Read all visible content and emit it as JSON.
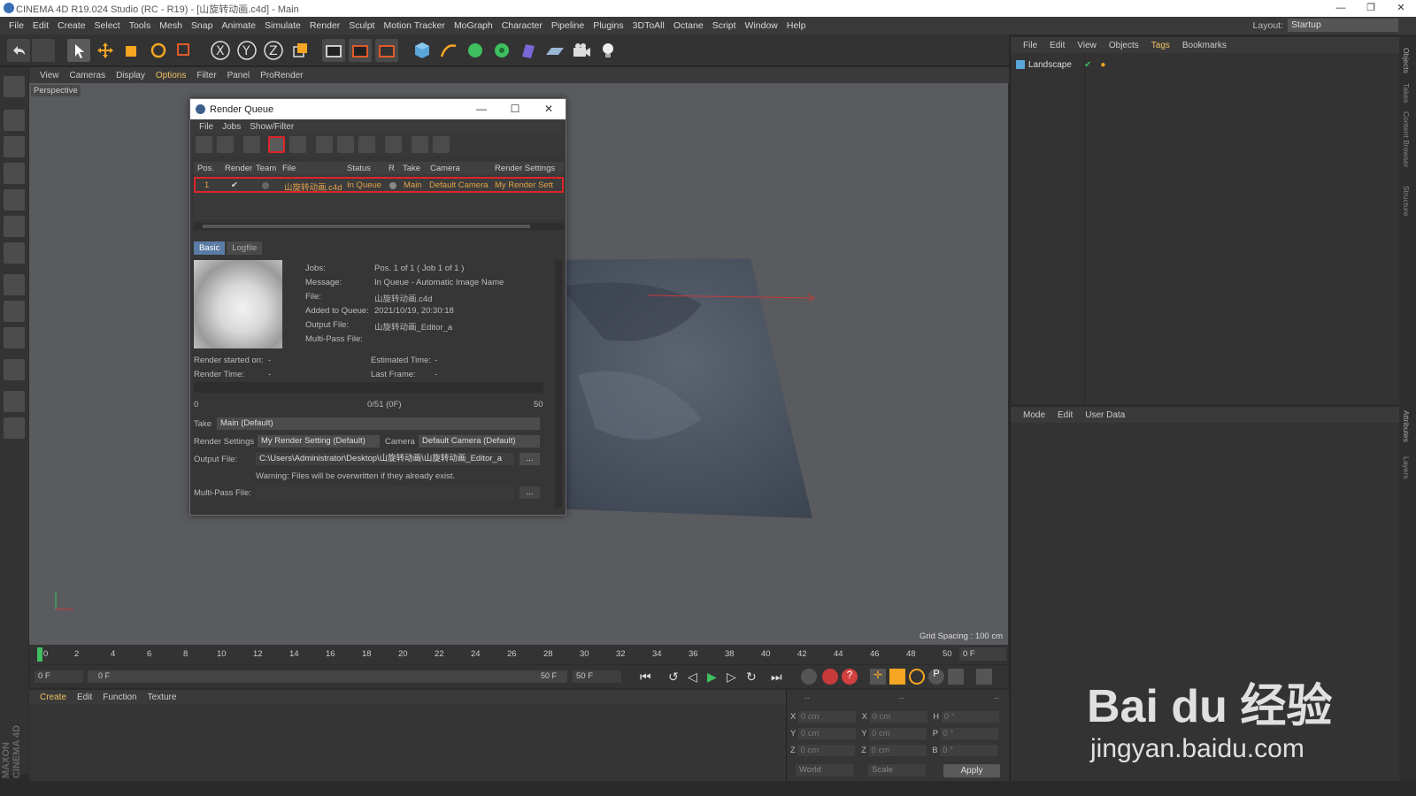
{
  "app": {
    "title": "CINEMA 4D R19.024 Studio (RC - R19) - [山旋转动画.c4d] - Main",
    "window_controls": [
      "—",
      "❐",
      "✕"
    ]
  },
  "menubar": {
    "items": [
      "File",
      "Edit",
      "Create",
      "Select",
      "Tools",
      "Mesh",
      "Snap",
      "Animate",
      "Simulate",
      "Render",
      "Sculpt",
      "Motion Tracker",
      "MoGraph",
      "Character",
      "Pipeline",
      "Plugins",
      "3DToAll",
      "Octane",
      "Script",
      "Window",
      "Help"
    ],
    "layout_label": "Layout:",
    "layout_value": "Startup"
  },
  "viewport_menu": {
    "items": [
      "View",
      "Cameras",
      "Display",
      "Options",
      "Filter",
      "Panel",
      "ProRender"
    ]
  },
  "viewport": {
    "label": "Perspective",
    "grid_spacing": "Grid Spacing : 100 cm"
  },
  "timeline": {
    "ticks": [
      "0",
      "2",
      "4",
      "6",
      "8",
      "10",
      "12",
      "14",
      "16",
      "18",
      "20",
      "22",
      "24",
      "26",
      "28",
      "30",
      "32",
      "34",
      "36",
      "38",
      "40",
      "42",
      "44",
      "46",
      "48",
      "50"
    ],
    "current_frame_field": "0 F",
    "start_field": "0 F",
    "range_start": "0 F",
    "range_end": "50 F",
    "end_field": "50 F"
  },
  "material_panel": {
    "menu": [
      "Create",
      "Edit",
      "Function",
      "Texture"
    ]
  },
  "coord_panel": {
    "header": [
      "--",
      "--",
      "--"
    ],
    "rows": [
      {
        "a": "X",
        "av": "0 cm",
        "b": "X",
        "bv": "0 cm",
        "c": "H",
        "cv": "0 °"
      },
      {
        "a": "Y",
        "av": "0 cm",
        "b": "Y",
        "bv": "0 cm",
        "c": "P",
        "cv": "0 °"
      },
      {
        "a": "Z",
        "av": "0 cm",
        "b": "Z",
        "bv": "0 cm",
        "c": "B",
        "cv": "0 °"
      }
    ],
    "world": "World",
    "scale": "Scale",
    "apply": "Apply"
  },
  "objects_panel": {
    "menu": [
      "File",
      "Edit",
      "View",
      "Objects",
      "Tags",
      "Bookmarks"
    ],
    "object_name": "Landscape"
  },
  "attributes_panel": {
    "menu": [
      "Mode",
      "Edit",
      "User Data"
    ]
  },
  "side_tabs": [
    "Objects",
    "Takes",
    "Content Browser",
    "Structure",
    "Attributes",
    "Layers"
  ],
  "maxon_logo": "MAXON CINEMA 4D",
  "watermark": {
    "logo_text": "Bai du 经验",
    "url": "jingyan.baidu.com"
  },
  "render_queue": {
    "title": "Render Queue",
    "menu": [
      "File",
      "Jobs",
      "Show/Filter"
    ],
    "columns": [
      "Pos.",
      "Render",
      "Team",
      "File",
      "Status",
      "R",
      "Take",
      "Camera",
      "Render Settings"
    ],
    "row": {
      "pos": "1",
      "render": "✔",
      "file": "山旋转动画.c4d",
      "status": "In Queue",
      "take": "Main",
      "camera": "Default Camera",
      "render_settings": "My Render Sett"
    },
    "tabs": [
      "Basic",
      "Logfile"
    ],
    "details": {
      "jobs_label": "Jobs:",
      "jobs": "Pos. 1 of 1 ( Job 1 of 1 )",
      "message_label": "Message:",
      "message": "In Queue - Automatic Image Name",
      "file_label": "File:",
      "file": "山旋转动画.c4d",
      "added_label": "Added to Queue:",
      "added": "2021/10/19, 20:30:18",
      "output_label": "Output File:",
      "output": "山旋转动画_Editor_a",
      "multipass_label": "Multi-Pass File:"
    },
    "render_started_label": "Render started on:",
    "render_started": "-",
    "estimated_label": "Estimated Time:",
    "estimated": "-",
    "render_time_label": "Render Time:",
    "render_time": "-",
    "last_frame_label": "Last Frame:",
    "last_frame": "-",
    "progress_min": "0",
    "progress_text": "0/51 (0F)",
    "progress_max": "50",
    "progress": 0,
    "take_label": "Take",
    "take_value": "Main (Default)",
    "rs_label": "Render Settings",
    "rs_value": "My Render Setting (Default)",
    "camera_label": "Camera",
    "camera_value": "Default Camera (Default)",
    "output_file_label": "Output File:",
    "output_file_value": "C:\\Users\\Administrator\\Desktop\\山旋转动画\\山旋转动画_Editor_a",
    "browse": "...",
    "warning": "Warning: Files will be overwritten if they already exist.",
    "multipass_file_label": "Multi-Pass File:",
    "multipass_browse": "..."
  },
  "colors": {
    "highlight_red": "#e0242a",
    "accent_orange": "#e3a24a",
    "tab_blue": "#5b7ca4"
  }
}
